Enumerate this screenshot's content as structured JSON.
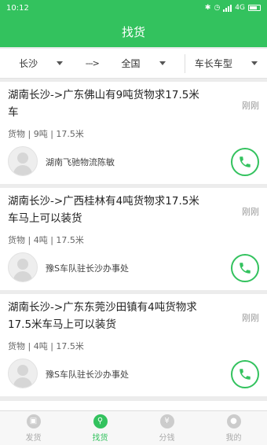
{
  "status": {
    "time": "10:12",
    "network": "4G"
  },
  "header": {
    "title": "找货"
  },
  "filters": {
    "origin": "长沙",
    "arrow": "--->",
    "destination": "全国",
    "vehicle": "车长车型"
  },
  "listings": [
    {
      "title": "湖南长沙->广东佛山有9吨货物求17.5米车",
      "time": "刚刚",
      "meta": "货物 | 9吨 | 17.5米",
      "company": "湖南飞驰物流陈敏"
    },
    {
      "title": "湖南长沙->广西桂林有4吨货物求17.5米车马上可以装货",
      "time": "刚刚",
      "meta": "货物 | 4吨 | 17.5米",
      "company": "豫S车队驻长沙办事处"
    },
    {
      "title": "湖南长沙->广东东莞沙田镇有4吨货物求17.5米车马上可以装货",
      "time": "刚刚",
      "meta": "货物 | 4吨 | 17.5米",
      "company": "豫S车队驻长沙办事处"
    }
  ],
  "tabs": [
    {
      "label": "发货",
      "icon": "box-icon"
    },
    {
      "label": "找货",
      "icon": "search-goods-icon"
    },
    {
      "label": "分钱",
      "icon": "yen-icon"
    },
    {
      "label": "我的",
      "icon": "user-icon"
    }
  ]
}
